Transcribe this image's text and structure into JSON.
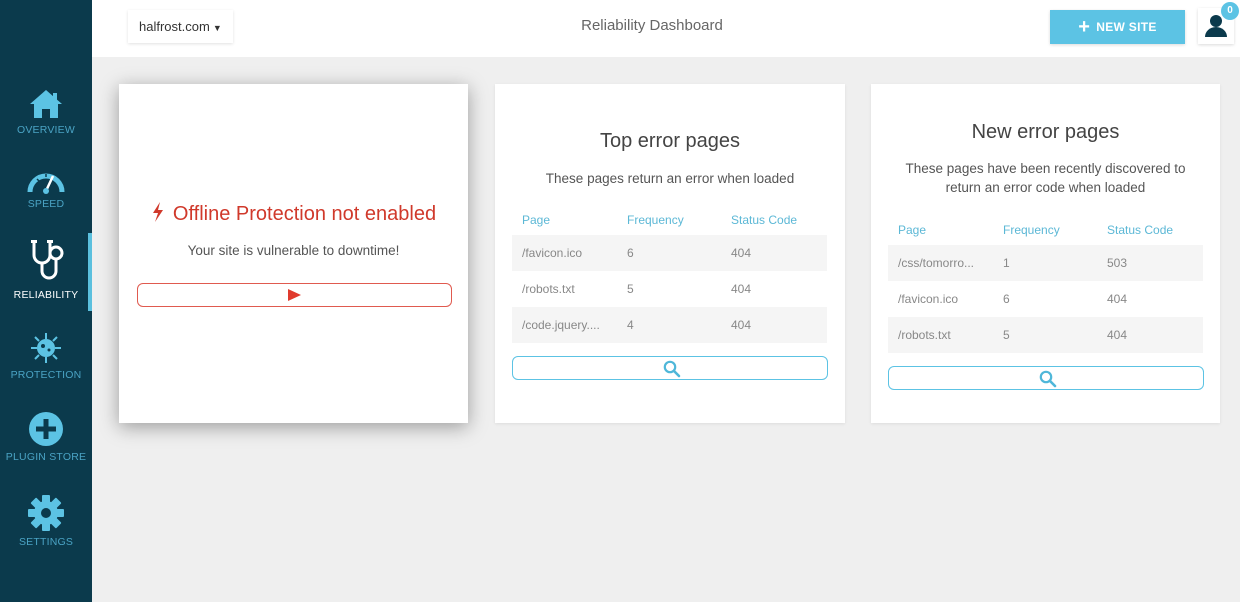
{
  "sidebar": {
    "items": [
      {
        "label": "OVERVIEW",
        "icon": "home-icon"
      },
      {
        "label": "SPEED",
        "icon": "speedometer-icon"
      },
      {
        "label": "RELIABILITY",
        "icon": "stethoscope-icon",
        "active": true
      },
      {
        "label": "PROTECTION",
        "icon": "virus-icon"
      },
      {
        "label": "PLUGIN STORE",
        "icon": "plus-circle-icon"
      },
      {
        "label": "SETTINGS",
        "icon": "gear-icon"
      }
    ]
  },
  "header": {
    "site": "halfrost.com",
    "title": "Reliability Dashboard",
    "new_site_label": "NEW SITE",
    "notification_count": "0"
  },
  "offline_card": {
    "title": "Offline Protection not enabled",
    "subtitle": "Your site is vulnerable to downtime!"
  },
  "top_errors": {
    "title": "Top error pages",
    "description": "These pages return an error when loaded",
    "columns": [
      "Page",
      "Frequency",
      "Status Code"
    ],
    "rows": [
      {
        "page": "/favicon.ico",
        "frequency": "6",
        "status": "404"
      },
      {
        "page": "/robots.txt",
        "frequency": "5",
        "status": "404"
      },
      {
        "page": "/code.jquery....",
        "frequency": "4",
        "status": "404"
      }
    ]
  },
  "new_errors": {
    "title": "New error pages",
    "description_line1": "These pages have been recently discovered to",
    "description_line2": "return an error code when loaded",
    "columns": [
      "Page",
      "Frequency",
      "Status Code"
    ],
    "rows": [
      {
        "page": "/css/tomorro...",
        "frequency": "1",
        "status": "503"
      },
      {
        "page": "/favicon.ico",
        "frequency": "6",
        "status": "404"
      },
      {
        "page": "/robots.txt",
        "frequency": "5",
        "status": "404"
      }
    ]
  },
  "colors": {
    "sidebar_bg": "#0b3a4c",
    "accent": "#5cc3e4",
    "error_red": "#d0392b"
  }
}
